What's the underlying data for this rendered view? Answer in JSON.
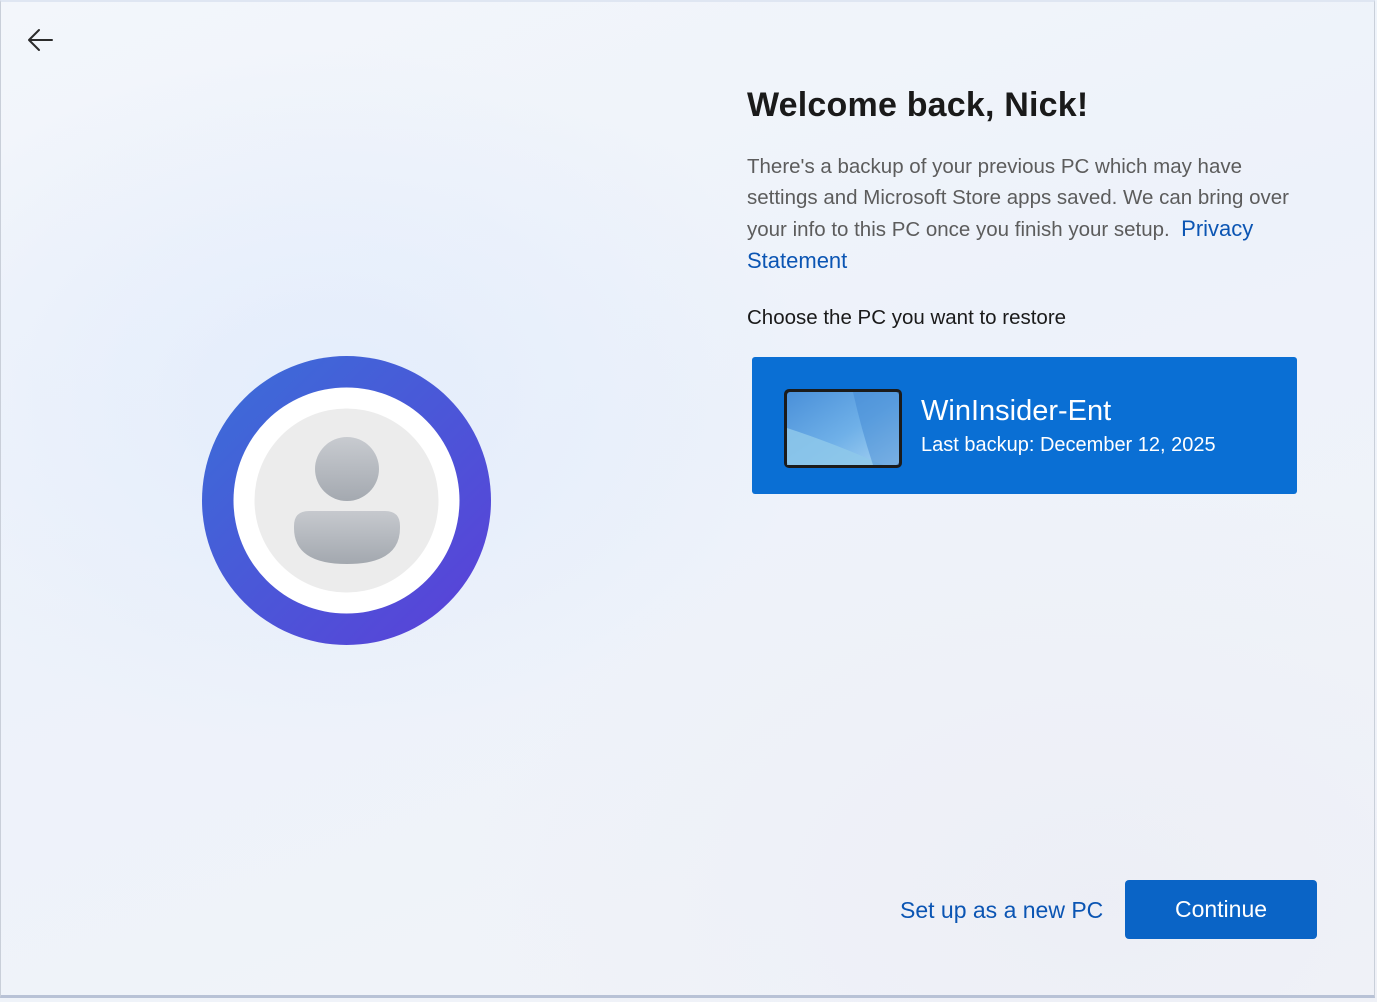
{
  "header": {
    "back_icon": "arrow-left-icon"
  },
  "main": {
    "title": "Welcome back, Nick!",
    "description": "There's a backup of your previous PC which may have settings and Microsoft Store apps saved. We can bring over your info to this PC once you finish your setup.",
    "privacy_link": "Privacy Statement",
    "choose_label": "Choose the PC you want to restore",
    "pc_card": {
      "name": "WinInsider-Ent",
      "backup": "Last backup: December 12, 2025",
      "icon": "laptop-thumbnail-icon"
    }
  },
  "avatar": {
    "icon": "user-avatar-icon"
  },
  "footer": {
    "setup_new_label": "Set up as a new PC",
    "continue_label": "Continue"
  },
  "colors": {
    "accent": "#0a6fd4",
    "link": "#0b55b3",
    "button": "#0a64c6"
  }
}
